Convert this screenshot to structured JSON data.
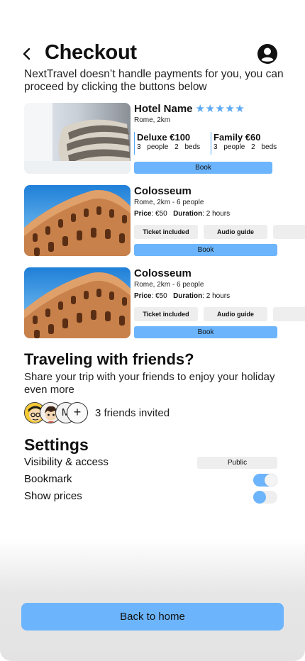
{
  "header": {
    "title": "Checkout",
    "subtitle": "NextTravel doesn’t handle payments for you, you can proceed by clicking the buttons below"
  },
  "hotel": {
    "name": "Hotel Name",
    "stars": "★★★★★",
    "location": "Rome, 2km",
    "rooms": [
      {
        "name": "Deluxe €100",
        "details": "3 people 2 beds"
      },
      {
        "name": "Family €60",
        "details": "3 people 2 beds"
      }
    ],
    "book_label": "Book"
  },
  "activities": [
    {
      "name": "Colosseum",
      "location": "Rome, 2km - 6 people",
      "price_label": "Price",
      "price": ": €50",
      "duration_label": "Duration",
      "duration": ": 2 hours",
      "tags": [
        "Ticket included",
        "Audio guide",
        ""
      ],
      "book_label": "Book"
    },
    {
      "name": "Colosseum",
      "location": "Rome, 2km - 6 people",
      "price_label": "Price",
      "price": ": €50",
      "duration_label": "Duration",
      "duration": ": 2 hours",
      "tags": [
        "Ticket included",
        "Audio guide",
        ""
      ],
      "book_label": "Book"
    }
  ],
  "friends": {
    "title": "Traveling with friends?",
    "subtitle": "Share your trip with your friends to enjoy your holiday even more",
    "avatar_initial": "M",
    "add_symbol": "+",
    "count_text": "3 friends invited"
  },
  "settings": {
    "title": "Settings",
    "visibility_label": "Visibility & access",
    "visibility_value": "Public",
    "bookmark_label": "Bookmark",
    "bookmark_on": true,
    "prices_label": "Show prices",
    "prices_on": false
  },
  "footer": {
    "home_label": "Back to home"
  },
  "colors": {
    "accent": "#6cb4fb",
    "chip": "#eeeeee",
    "text": "#111111"
  }
}
